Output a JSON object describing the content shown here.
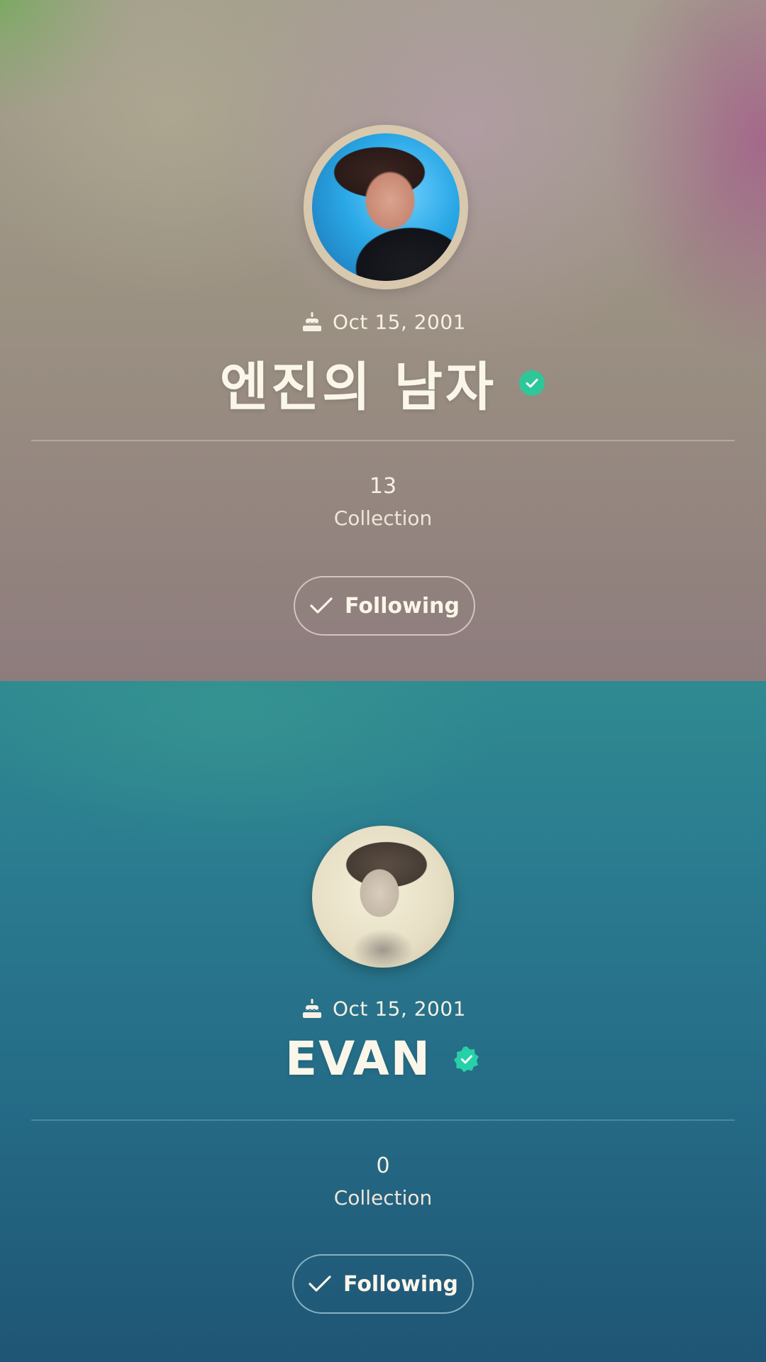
{
  "profiles": [
    {
      "birthday": "Oct 15, 2001",
      "name": "엔진의 남자",
      "verified_icon": "verified-badge-icon",
      "collection_count": "13",
      "collection_label": "Collection",
      "follow_label": "Following",
      "badge_color": "#2ec79a"
    },
    {
      "birthday": "Oct 15, 2001",
      "name": "EVAN",
      "verified_icon": "verified-badge-icon",
      "collection_count": "0",
      "collection_label": "Collection",
      "follow_label": "Following",
      "badge_color": "#26d1a8"
    }
  ]
}
